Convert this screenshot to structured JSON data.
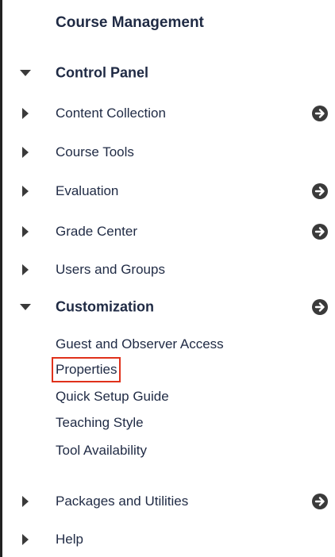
{
  "panel": {
    "title": "Course Management",
    "control_panel_label": "Control Panel",
    "items": [
      {
        "label": "Content Collection",
        "has_arrow": true
      },
      {
        "label": "Course Tools",
        "has_arrow": false
      },
      {
        "label": "Evaluation",
        "has_arrow": true
      },
      {
        "label": "Grade Center",
        "has_arrow": true
      },
      {
        "label": "Users and Groups",
        "has_arrow": false
      }
    ],
    "customization": {
      "label": "Customization",
      "subitems": [
        "Guest and Observer Access",
        "Properties",
        "Quick Setup Guide",
        "Teaching Style",
        "Tool Availability"
      ]
    },
    "bottom_items": [
      {
        "label": "Packages and Utilities",
        "has_arrow": true
      },
      {
        "label": "Help",
        "has_arrow": false
      }
    ]
  },
  "colors": {
    "text": "#1f2a44",
    "icon": "#3a3a3a",
    "highlight": "#e0311b"
  },
  "icons": {
    "expanded": "triangle-down-icon",
    "collapsed": "triangle-right-icon",
    "action": "circle-arrow-right-icon"
  }
}
